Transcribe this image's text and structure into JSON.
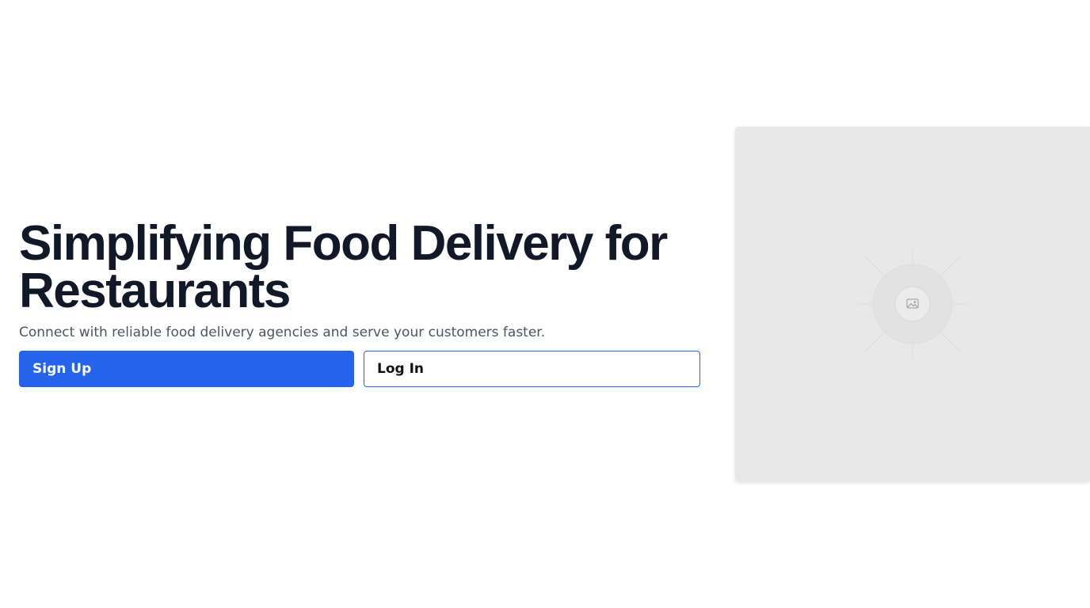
{
  "hero": {
    "headline": "Simplifying Food Delivery for Restaurants",
    "subtitle": "Connect with reliable food delivery agencies and serve your customers faster."
  },
  "actions": {
    "signup_label": "Sign Up",
    "login_label": "Log In"
  },
  "image": {
    "icon": "image-placeholder-icon"
  },
  "colors": {
    "primary": "#2563eb",
    "headline": "#111827",
    "subtitle": "#4b5563",
    "image_bg": "#e8e8e8"
  }
}
